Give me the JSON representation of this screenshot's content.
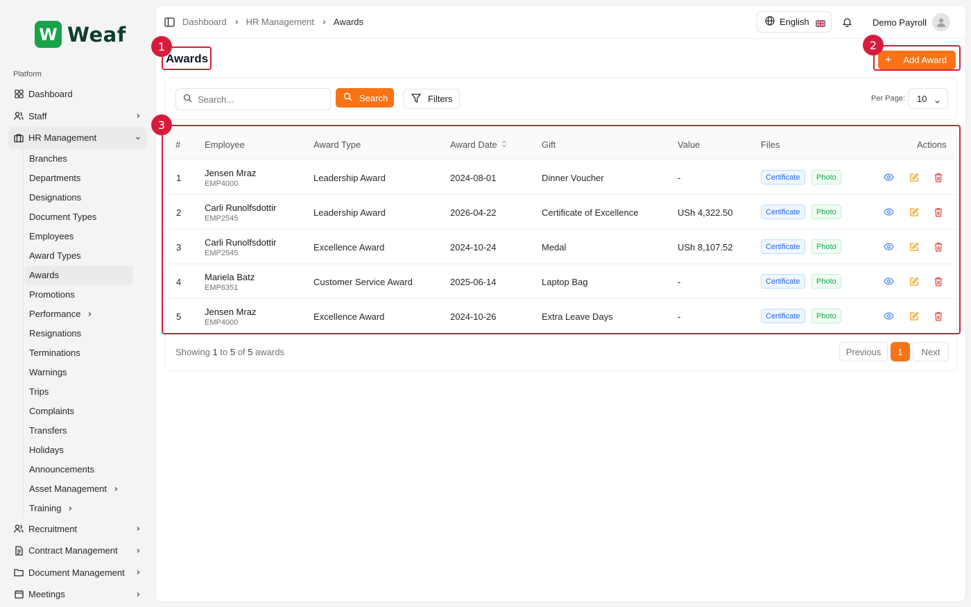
{
  "brand": {
    "logo_letter": "W",
    "name": "Weaf",
    "color": "#16a34a"
  },
  "sidebar": {
    "section_label": "Platform",
    "top_items": [
      {
        "label": "Dashboard",
        "icon": "grid-icon"
      },
      {
        "label": "Staff",
        "icon": "users-icon"
      },
      {
        "label": "HR Management",
        "icon": "briefcase-icon"
      }
    ],
    "hr_sub_items": [
      {
        "label": "Branches"
      },
      {
        "label": "Departments"
      },
      {
        "label": "Designations"
      },
      {
        "label": "Document Types"
      },
      {
        "label": "Employees"
      },
      {
        "label": "Award Types"
      },
      {
        "label": "Awards"
      },
      {
        "label": "Promotions"
      },
      {
        "label": "Performance"
      },
      {
        "label": "Resignations"
      },
      {
        "label": "Terminations"
      },
      {
        "label": "Warnings"
      },
      {
        "label": "Trips"
      },
      {
        "label": "Complaints"
      },
      {
        "label": "Transfers"
      },
      {
        "label": "Holidays"
      },
      {
        "label": "Announcements"
      },
      {
        "label": "Asset Management"
      },
      {
        "label": "Training"
      }
    ],
    "bottom_items": [
      {
        "label": "Recruitment",
        "icon": "user-search-icon"
      },
      {
        "label": "Contract Management",
        "icon": "file-text-icon"
      },
      {
        "label": "Document Management",
        "icon": "folder-icon"
      },
      {
        "label": "Meetings",
        "icon": "calendar-icon"
      }
    ]
  },
  "header": {
    "breadcrumb": [
      "Dashboard",
      "HR Management",
      "Awards"
    ],
    "language": "English",
    "user_name": "Demo Payroll"
  },
  "page": {
    "title": "Awards",
    "add_button": "Add Award"
  },
  "filters": {
    "search_placeholder": "Search...",
    "search_button": "Search",
    "filters_button": "Filters",
    "per_page_label": "Per Page:",
    "per_page_value": "10"
  },
  "table": {
    "headers": [
      "#",
      "Employee",
      "Award Type",
      "Award Date",
      "Gift",
      "Value",
      "Files",
      "Actions"
    ],
    "rows": [
      {
        "num": "1",
        "name": "Jensen Mraz",
        "emp_id": "EMP4000",
        "award_type": "Leadership Award",
        "date": "2024-08-01",
        "gift": "Dinner Voucher",
        "value": "-",
        "file1": "Certificate",
        "file2": "Photo"
      },
      {
        "num": "2",
        "name": "Carli Runolfsdottir",
        "emp_id": "EMP2545",
        "award_type": "Leadership Award",
        "date": "2026-04-22",
        "gift": "Certificate of Excellence",
        "value": "USh 4,322.50",
        "file1": "Certificate",
        "file2": "Photo"
      },
      {
        "num": "3",
        "name": "Carli Runolfsdottir",
        "emp_id": "EMP2545",
        "award_type": "Excellence Award",
        "date": "2024-10-24",
        "gift": "Medal",
        "value": "USh 8,107.52",
        "file1": "Certificate",
        "file2": "Photo"
      },
      {
        "num": "4",
        "name": "Mariela Batz",
        "emp_id": "EMP6351",
        "award_type": "Customer Service Award",
        "date": "2025-06-14",
        "gift": "Laptop Bag",
        "value": "-",
        "file1": "Certificate",
        "file2": "Photo"
      },
      {
        "num": "5",
        "name": "Jensen Mraz",
        "emp_id": "EMP4000",
        "award_type": "Excellence Award",
        "date": "2024-10-26",
        "gift": "Extra Leave Days",
        "value": "-",
        "file1": "Certificate",
        "file2": "Photo"
      }
    ]
  },
  "footer": {
    "showing_prefix": "Showing",
    "from": "1",
    "to_word": "to",
    "to": "5",
    "of_word": "of",
    "total": "5",
    "suffix": "awards",
    "prev": "Previous",
    "current_page": "1",
    "next": "Next"
  },
  "annotations": [
    "1",
    "2",
    "3"
  ],
  "colors": {
    "accent": "#f97316",
    "annotation": "#d81b3c",
    "view": "#3b82f6",
    "edit": "#f59e0b",
    "delete": "#ef4444"
  }
}
